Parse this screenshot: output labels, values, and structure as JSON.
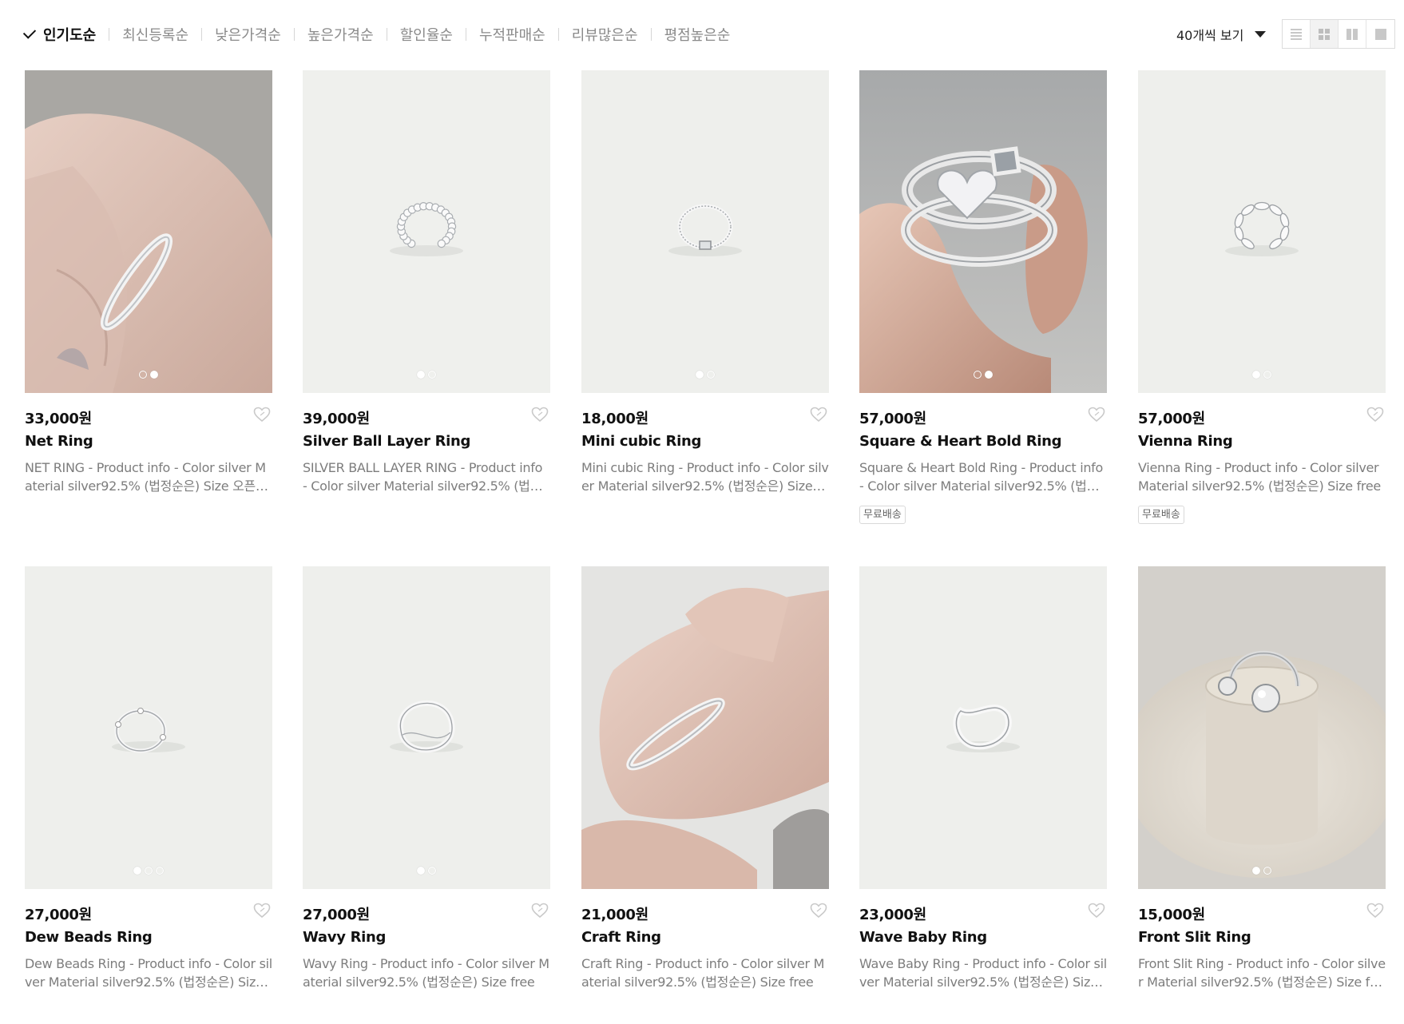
{
  "sort": {
    "options": [
      "인기도순",
      "최신등록순",
      "낮은가격순",
      "높은가격순",
      "할인율순",
      "누적판매순",
      "리뷰많은순",
      "평점높은순"
    ],
    "active": "인기도순"
  },
  "per_page": {
    "label": "40개씩 보기"
  },
  "view_modes": [
    "list",
    "grid-4",
    "grid-2",
    "single"
  ],
  "view_mode_active": "grid-4",
  "products": [
    {
      "price": "33,000원",
      "name": "Net Ring",
      "desc": "NET RING - Product info - Color silver Material silver92.5% (법정순은) Size 오픈링으로 사이즈 조절 가능",
      "badge": "",
      "dots": 2,
      "dot_active": 1,
      "image": "hand-ring"
    },
    {
      "price": "39,000원",
      "name": "Silver Ball Layer Ring",
      "desc": "SILVER BALL LAYER RING - Product info - Color silver Material silver92.5% (법정순은) Size free",
      "badge": "",
      "dots": 2,
      "dot_active": 0,
      "image": "ball-ring"
    },
    {
      "price": "18,000원",
      "name": "Mini cubic Ring",
      "desc": "Mini cubic Ring - Product info - Color silver Material silver92.5% (법정순은) Size free",
      "badge": "",
      "dots": 2,
      "dot_active": 0,
      "image": "cubic-ring"
    },
    {
      "price": "57,000원",
      "name": "Square & Heart Bold Ring",
      "desc": "Square & Heart Bold Ring - Product info - Color silver Material silver92.5% (법정순은) Size free",
      "badge": "무료배송",
      "dots": 2,
      "dot_active": 1,
      "image": "bold-ring"
    },
    {
      "price": "57,000원",
      "name": "Vienna Ring",
      "desc": "Vienna Ring - Product info - Color silver Material silver92.5% (법정순은) Size free",
      "badge": "무료배송",
      "dots": 2,
      "dot_active": 0,
      "image": "vienna-ring"
    },
    {
      "price": "27,000원",
      "name": "Dew Beads Ring",
      "desc": "Dew Beads Ring - Product info - Color silver Material silver92.5% (법정순은) Size free",
      "badge": "",
      "dots": 3,
      "dot_active": 0,
      "image": "dew-ring"
    },
    {
      "price": "27,000원",
      "name": "Wavy Ring",
      "desc": "Wavy Ring - Product info - Color silver Material silver92.5% (법정순은) Size free",
      "badge": "",
      "dots": 2,
      "dot_active": 0,
      "image": "wavy-ring"
    },
    {
      "price": "21,000원",
      "name": "Craft Ring",
      "desc": "Craft Ring - Product info - Color silver Material silver92.5% (법정순은) Size free",
      "badge": "",
      "dots": 0,
      "dot_active": 0,
      "image": "hand-ring-2"
    },
    {
      "price": "23,000원",
      "name": "Wave Baby Ring",
      "desc": "Wave Baby Ring - Product info - Color silver Material silver92.5% (법정순은) Size free",
      "badge": "",
      "dots": 0,
      "dot_active": 0,
      "image": "wave-baby-ring"
    },
    {
      "price": "15,000원",
      "name": "Front Slit Ring",
      "desc": "Front Slit Ring - Product info - Color silver Material silver92.5% (법정순은) Size free",
      "badge": "",
      "dots": 2,
      "dot_active": 0,
      "image": "slit-ring"
    }
  ]
}
